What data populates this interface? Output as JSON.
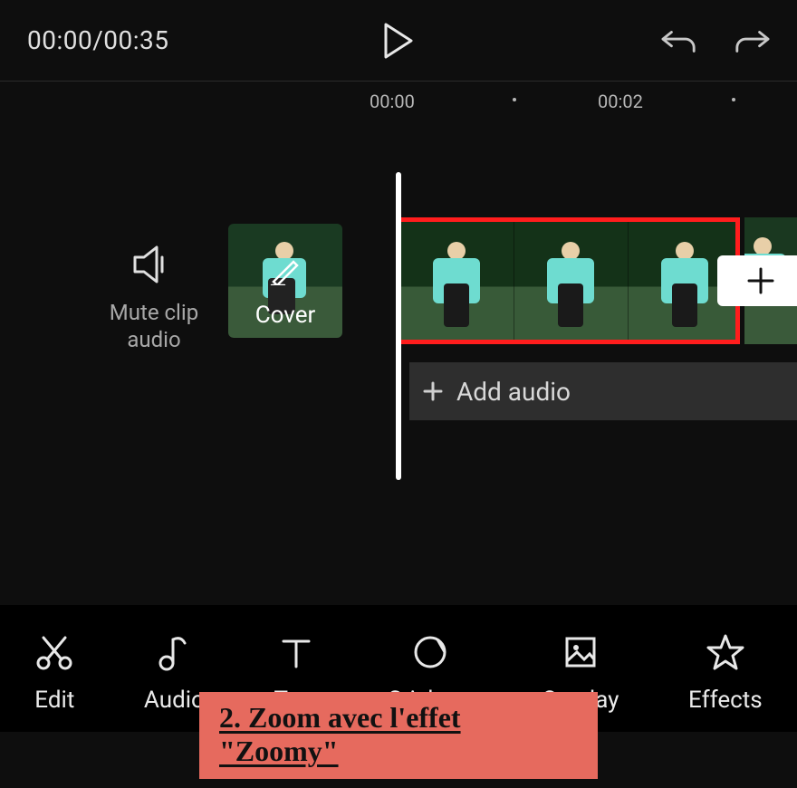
{
  "header": {
    "time_current": "00:00",
    "time_total": "00:35"
  },
  "ruler": {
    "tick_0": "00:00",
    "tick_1": "00:02"
  },
  "timeline": {
    "mute_label": "Mute clip audio",
    "cover_label": "Cover",
    "add_audio_label": "Add audio"
  },
  "toolbar": {
    "items": [
      {
        "label": "Edit"
      },
      {
        "label": "Audio"
      },
      {
        "label": "Text"
      },
      {
        "label": "Stickers"
      },
      {
        "label": "Overlay"
      },
      {
        "label": "Effects"
      }
    ]
  },
  "caption": {
    "text": "2. Zoom avec l'effet \"Zoomy\""
  }
}
